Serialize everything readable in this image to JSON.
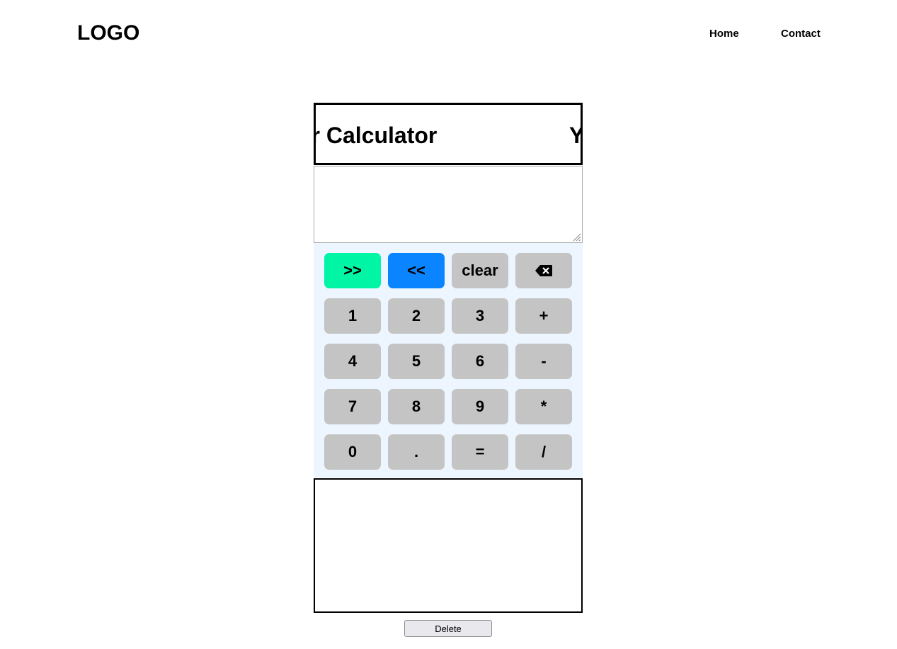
{
  "header": {
    "logo": "LOGO",
    "nav": [
      {
        "label": "Home"
      },
      {
        "label": "Contact"
      }
    ]
  },
  "banner": {
    "text_visible_left": "ur Calculator",
    "text_visible_right": "Y"
  },
  "display": {
    "value": ""
  },
  "keypad": {
    "rows": [
      [
        {
          "label": ">>"
        },
        {
          "label": "<<"
        },
        {
          "label": "clear"
        },
        {
          "label": "",
          "icon": "backspace-icon"
        }
      ],
      [
        {
          "label": "1"
        },
        {
          "label": "2"
        },
        {
          "label": "3"
        },
        {
          "label": "+"
        }
      ],
      [
        {
          "label": "4"
        },
        {
          "label": "5"
        },
        {
          "label": "6"
        },
        {
          "label": "-"
        }
      ],
      [
        {
          "label": "7"
        },
        {
          "label": "8"
        },
        {
          "label": "9"
        },
        {
          "label": "*"
        }
      ],
      [
        {
          "label": "0"
        },
        {
          "label": "."
        },
        {
          "label": "="
        },
        {
          "label": "/"
        }
      ]
    ]
  },
  "history": {
    "items": []
  },
  "actions": {
    "delete_label": "Delete"
  },
  "colors": {
    "keypad_bg": "#edf6ff",
    "key_bg": "#c4c4c4",
    "forward_key": "#00f5a5",
    "back_key": "#0a84ff"
  }
}
